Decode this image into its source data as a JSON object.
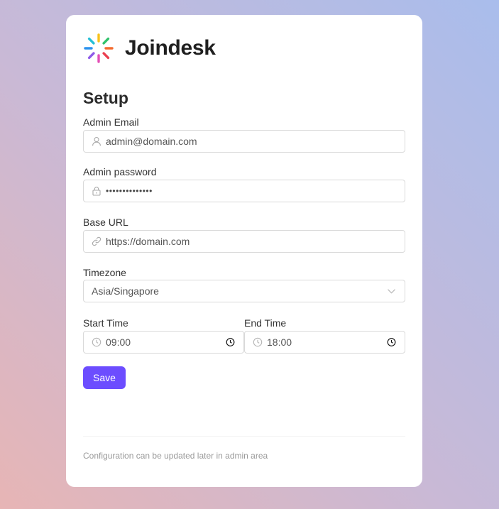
{
  "app": {
    "brand": "Joindesk"
  },
  "form": {
    "title": "Setup",
    "admin_email": {
      "label": "Admin Email",
      "value": "admin@domain.com",
      "icon": "user-icon"
    },
    "admin_password": {
      "label": "Admin password",
      "value": "••••••••••••••",
      "icon": "lock-icon"
    },
    "base_url": {
      "label": "Base URL",
      "value": "https://domain.com",
      "icon": "link-icon"
    },
    "timezone": {
      "label": "Timezone",
      "value": "Asia/Singapore",
      "icon": "chevron-down-icon"
    },
    "start_time": {
      "label": "Start Time",
      "value": "09:00",
      "icon": "clock-icon"
    },
    "end_time": {
      "label": "End Time",
      "value": "18:00",
      "icon": "clock-icon"
    },
    "save_label": "Save"
  },
  "footer": {
    "note": "Configuration can be updated later in admin area"
  },
  "colors": {
    "accent": "#6c4dff",
    "background_from": "#e7b5b5",
    "background_to": "#a9bdec"
  }
}
